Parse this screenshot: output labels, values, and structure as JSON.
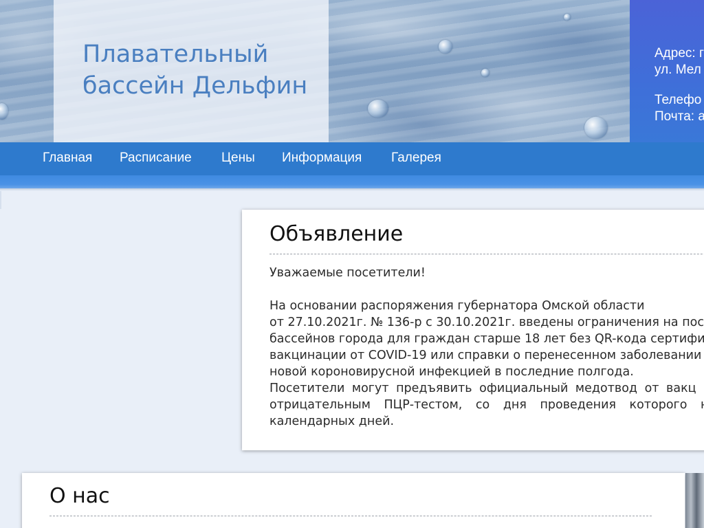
{
  "header": {
    "site_title_line1": "Плавательный",
    "site_title_line2": "бассейн Дельфин",
    "contact": {
      "address_line1": "Адрес: г",
      "address_line2": "ул. Мел",
      "phone": "Телефо",
      "email": "Почта: а"
    }
  },
  "nav": {
    "items": [
      {
        "label": "Главная"
      },
      {
        "label": "Расписание"
      },
      {
        "label": "Цены"
      },
      {
        "label": "Информация"
      },
      {
        "label": "Галерея"
      }
    ]
  },
  "announcement": {
    "title": "Объявление",
    "greeting": "Уважаемые посетители!",
    "lines": [
      "На основании распоряжения губернатора Омской области",
      "от 27.10.2021г. № 136-р с 30.10.2021г. введены ограничения на пос",
      "бассейнов города для граждан старше 18 лет без QR-кода сертифи",
      "вакцинации от COVID-19 или справки о перенесенном заболевании",
      "новой короновирусной инфекцией в последние полгода."
    ],
    "justified_lines": [
      "Посетители могут предъявить официальный медотвод от вакц",
      "отрицательным ПЦР-тестом, со дня проведения которого не"
    ],
    "last_line": "календарных дней."
  },
  "about": {
    "title": "О нас"
  },
  "colors": {
    "nav_bg": "#2e7acd",
    "title_text": "#4a7fc0",
    "contact_bg": "#4b63d7",
    "page_bg": "#e9eff8"
  }
}
